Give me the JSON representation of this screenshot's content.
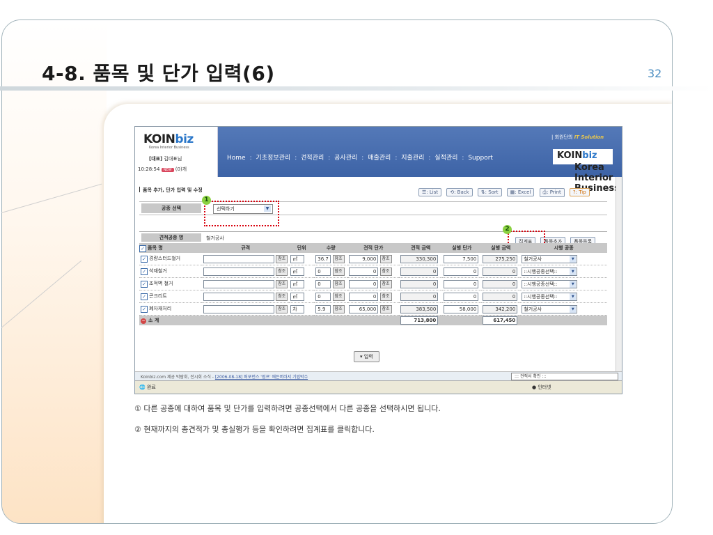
{
  "slide": {
    "title": "4-8. 품목 및 단가 입력(6)",
    "page_number": "32"
  },
  "app": {
    "logo_main": "KOIN",
    "logo_biz": "biz",
    "logo_sub": "Korea Interior Business",
    "user_label": "[대표]",
    "user_name": "김대표님",
    "time": "10:28:54",
    "new_badge": "NEW",
    "message_count": "(0)개",
    "member_label": "| 회원단의",
    "member_tagline": "IT Solution",
    "nav": [
      "Home",
      "기초정보관리",
      "견적관리",
      "공사관리",
      "매출관리",
      "지출관리",
      "실적관리",
      "Support"
    ],
    "nav_sep": ":"
  },
  "toolbar": {
    "title": "품목 추가, 단가 입력 및 수정",
    "buttons": [
      "List",
      "Back",
      "Sort",
      "Excel",
      "Print",
      "Tip"
    ]
  },
  "trade_select": {
    "label": "공종 선택",
    "value": "선택하기",
    "callout": "1"
  },
  "group": {
    "label": "견적공종 명",
    "value": "철거공사",
    "buttons": [
      "집계표",
      "품목추가",
      "품목등록"
    ],
    "callout": "2"
  },
  "table": {
    "headers": [
      "품목 명",
      "규격",
      "단위",
      "수량",
      "견적 단가",
      "견적 금액",
      "실행 단가",
      "실행 금액",
      "시행 공종"
    ],
    "ref_label": "참조",
    "rows": [
      {
        "name": "경량스터드철거",
        "spec": "",
        "unit": "㎡",
        "qty": "36.7",
        "est_price": "9,000",
        "est_amount": "330,300",
        "exec_price": "7,500",
        "exec_amount": "275,250",
        "trade": "철거공사"
      },
      {
        "name": "석재철거",
        "spec": "",
        "unit": "㎡",
        "qty": "0",
        "est_price": "0",
        "est_amount": "0",
        "exec_price": "0",
        "exec_amount": "0",
        "trade": "::시행공종선택::"
      },
      {
        "name": "조적벽 철거",
        "spec": "",
        "unit": "㎡",
        "qty": "0",
        "est_price": "0",
        "est_amount": "0",
        "exec_price": "0",
        "exec_amount": "0",
        "trade": "::시행공종선택::"
      },
      {
        "name": "콘크리트",
        "spec": "",
        "unit": "㎡",
        "qty": "0",
        "est_price": "0",
        "est_amount": "0",
        "exec_price": "0",
        "exec_amount": "0",
        "trade": "::시행공종선택::"
      },
      {
        "name": "폐자재처리",
        "spec": "",
        "unit": "차",
        "qty": "5.9",
        "est_price": "65,000",
        "est_amount": "383,500",
        "exec_price": "58,000",
        "exec_amount": "342,200",
        "trade": "철거공사"
      }
    ],
    "subtotal_label": "소 계",
    "subtotal_est": "713,800",
    "subtotal_exec": "617,450"
  },
  "submit_label": "입력",
  "statusbar": {
    "notice_prefix": "Koinbiz.com 제공 박람회, 전시회 소식 - ",
    "notice_link": "[2006-08-18] 퍼포먼스 '점프' 에든버러서 기립박수",
    "confirm_dropdown": "::: 견적서 확인 :::",
    "done": "완료",
    "zone": "인터넷"
  },
  "notes": [
    "① 다른 공종에 대하여 품목 및 단가를 입력하려면 공종선택에서 다른 공종을 선택하시면 됩니다.",
    "② 현재까지의 총견적가 및 총실행가 등을 확인하려면 집계표를 클릭합니다."
  ],
  "colors": {
    "header_blue": "#3d63a6",
    "callout_red": "#d8000c",
    "callout_green": "#8bd141",
    "page_number": "#4d8fc2"
  }
}
